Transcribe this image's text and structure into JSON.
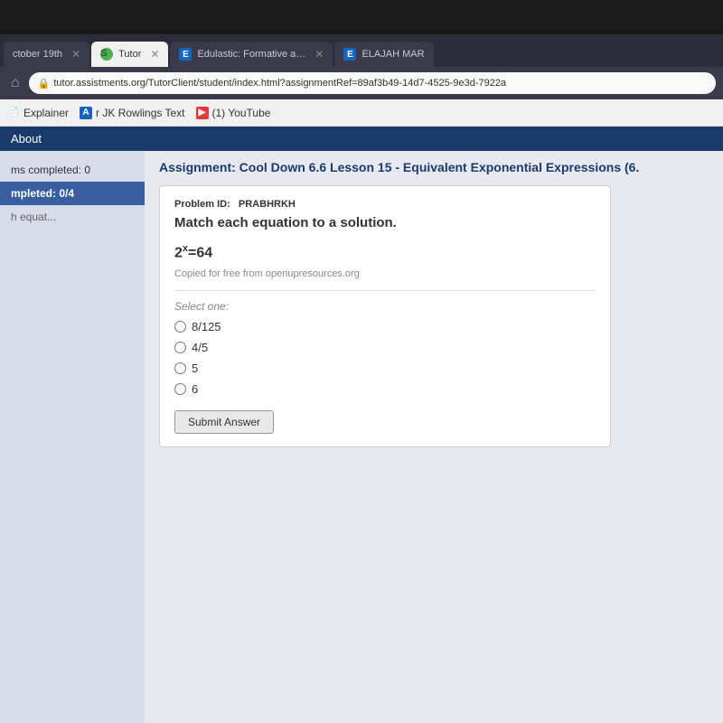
{
  "topBar": {
    "height": 38
  },
  "tabs": [
    {
      "id": "tab1",
      "label": "ctober 19th",
      "icon": "x",
      "active": false,
      "iconType": "close"
    },
    {
      "id": "tab2",
      "label": "Tutor",
      "icon": "S",
      "active": true,
      "iconType": "green"
    },
    {
      "id": "tab3",
      "label": "Edulastic: Formative and Summ",
      "icon": "E",
      "active": false,
      "iconType": "blue"
    },
    {
      "id": "tab4",
      "label": "ELAJAH MAR",
      "icon": "E",
      "active": false,
      "iconType": "blue2"
    }
  ],
  "addressBar": {
    "url": "tutor.assistments.org/TutorClient/student/index.html?assignmentRef=89af3b49-14d7-4525-9e3d-7922a"
  },
  "bookmarks": [
    {
      "id": "bm1",
      "label": "Explainer",
      "iconType": "plain"
    },
    {
      "id": "bm2",
      "label": "r JK Rowlings Text",
      "iconType": "blue"
    },
    {
      "id": "bm3",
      "label": "(1) YouTube",
      "iconType": "red"
    }
  ],
  "aboutBar": {
    "label": "About"
  },
  "sidebar": {
    "items": [
      {
        "id": "s1",
        "label": "ms completed: 0",
        "type": "normal"
      },
      {
        "id": "s2",
        "label": "mpleted: 0/4",
        "type": "highlight"
      },
      {
        "id": "s3",
        "label": "h equat...",
        "type": "muted"
      }
    ]
  },
  "assignment": {
    "title": "Assignment: Cool Down 6.6 Lesson 15 - Equivalent Exponential Expressions (6.",
    "problem": {
      "id_label": "Problem ID:",
      "id_value": "PRABHRKH",
      "question": "Match each equation to a solution.",
      "equation": "2",
      "exponent": "x",
      "equals": "=64",
      "copied_text": "Copied for free from openupresources.org",
      "select_label": "Select one:",
      "options": [
        {
          "id": "opt1",
          "value": "8/125",
          "label": "8/125"
        },
        {
          "id": "opt2",
          "value": "4/5",
          "label": "4/5"
        },
        {
          "id": "opt3",
          "value": "5",
          "label": "5"
        },
        {
          "id": "opt4",
          "value": "6",
          "label": "6"
        }
      ],
      "submit_label": "Submit Answer"
    }
  },
  "colors": {
    "navBlue": "#1a3a6b",
    "sidebarHighlight": "#3a5fa0",
    "pageBackground": "#e8e8f0"
  }
}
